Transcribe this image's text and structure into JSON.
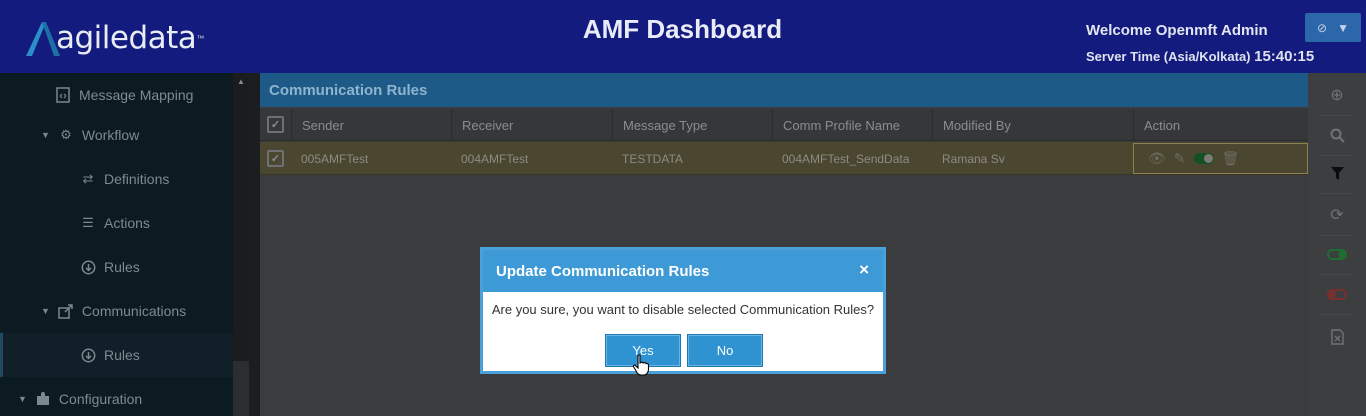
{
  "header": {
    "brand": "agiledata",
    "brand_tm": "™",
    "title": "AMF Dashboard",
    "welcome": "Welcome Openmft Admin",
    "server_time_label": "Server Time (Asia/Kolkata)",
    "server_time": "15:40:15",
    "user_menu_icon": "power-icon"
  },
  "sidebar": {
    "items": [
      {
        "label": "Message Mapping",
        "icon": "file-code-icon"
      },
      {
        "label": "Workflow",
        "icon": "gear-icon"
      },
      {
        "label": "Definitions",
        "icon": "exchange-icon"
      },
      {
        "label": "Actions",
        "icon": "list-icon"
      },
      {
        "label": "Rules",
        "icon": "circle-arrow-icon"
      },
      {
        "label": "Communications",
        "icon": "share-icon"
      },
      {
        "label": "Rules",
        "icon": "circle-arrow-icon"
      },
      {
        "label": "Configuration",
        "icon": "puzzle-icon"
      }
    ]
  },
  "panel": {
    "title": "Communication Rules",
    "columns": [
      "Sender",
      "Receiver",
      "Message Type",
      "Comm Profile Name",
      "Modified By",
      "Action"
    ],
    "rows": [
      {
        "sender": "005AMFTest",
        "receiver": "004AMFTest",
        "message_type": "TESTDATA",
        "comm_profile_name": "004AMFTest_SendData",
        "modified_by": "Ramana Sv"
      }
    ]
  },
  "toolbar": {
    "buttons": [
      "add-icon",
      "search-icon",
      "filter-icon",
      "refresh-icon",
      "toggle-on-icon",
      "toggle-off-icon",
      "export-icon"
    ]
  },
  "modal": {
    "title": "Update Communication Rules",
    "close": "×",
    "message": "Are you sure, you want to disable selected Communication Rules?",
    "yes": "Yes",
    "no": "No"
  },
  "colors": {
    "header_bg": "#131b7e",
    "panel_title_bg": "#1d5a87",
    "modal_header_bg": "#3d9ad7",
    "button_bg": "#2f93d2",
    "selected_row_bg": "#4b4630"
  }
}
